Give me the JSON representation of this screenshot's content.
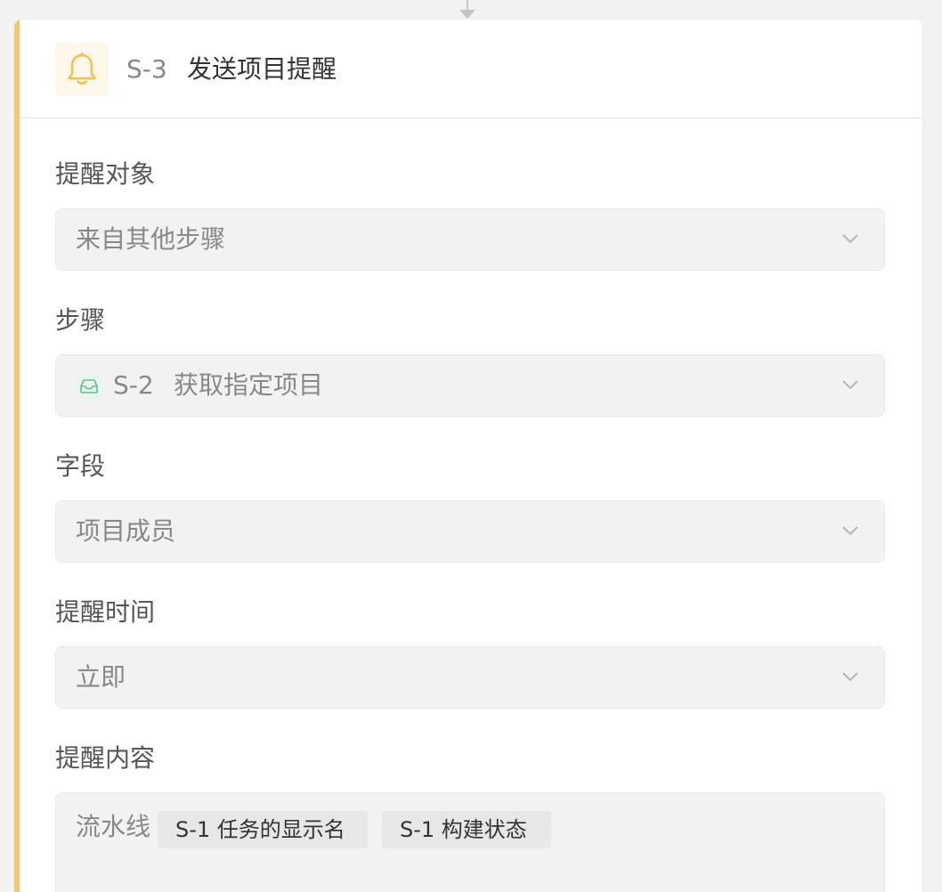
{
  "step": {
    "id": "S-3",
    "title": "发送项目提醒",
    "icon": "bell-icon",
    "accent_color": "#f5c86a"
  },
  "fields": {
    "target": {
      "label": "提醒对象",
      "value": "来自其他步骤"
    },
    "step_ref": {
      "label": "步骤",
      "icon": "inbox-icon",
      "id": "S-2",
      "name": "获取指定项目"
    },
    "field": {
      "label": "字段",
      "value": "项目成员"
    },
    "time": {
      "label": "提醒时间",
      "value": "立即"
    },
    "content": {
      "label": "提醒内容",
      "text": "流水线",
      "tags": [
        "S-1 任务的显示名",
        "S-1 构建状态"
      ]
    }
  }
}
